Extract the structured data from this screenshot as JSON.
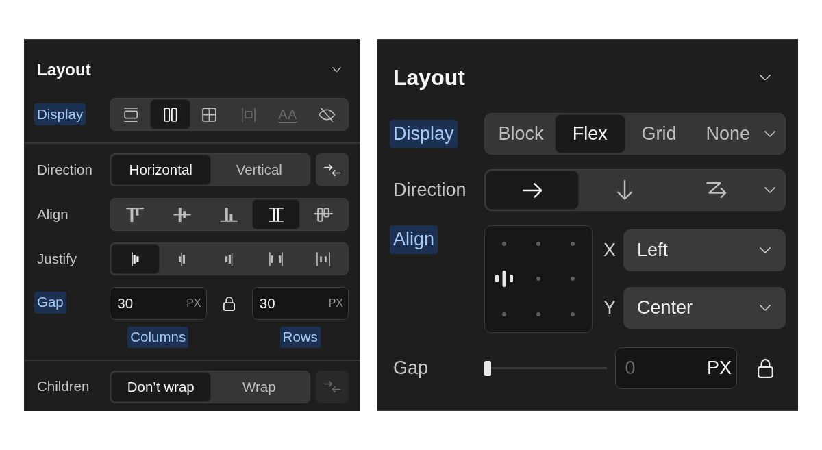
{
  "left_panel": {
    "title": "Layout",
    "sections": [
      {
        "rows": [
          {
            "kind": "icons",
            "label": "Display",
            "highlighted": true,
            "options": [
              {
                "kind": "block",
                "selected": false,
                "disabled": false
              },
              {
                "kind": "flex",
                "selected": true,
                "disabled": false
              },
              {
                "kind": "grid",
                "selected": false,
                "disabled": false
              },
              {
                "kind": "inline_block",
                "selected": false,
                "disabled": true
              },
              {
                "kind": "inline",
                "text": "AA",
                "selected": false,
                "disabled": true
              },
              {
                "kind": "none",
                "selected": false,
                "disabled": false
              }
            ]
          }
        ]
      },
      {
        "rows": [
          {
            "kind": "texts",
            "label": "Direction",
            "highlighted": false,
            "options": [
              {
                "text": "Horizontal",
                "selected": true
              },
              {
                "text": "Vertical",
                "selected": false
              }
            ],
            "reverse": {
              "disabled": false
            }
          },
          {
            "kind": "icons",
            "label": "Align",
            "highlighted": false,
            "options": [
              {
                "kind": "align_start",
                "selected": false
              },
              {
                "kind": "align_center",
                "selected": false
              },
              {
                "kind": "align_end",
                "selected": false
              },
              {
                "kind": "align_stretch",
                "selected": true
              },
              {
                "kind": "align_baseline",
                "selected": false
              }
            ]
          },
          {
            "kind": "icons",
            "label": "Justify",
            "highlighted": false,
            "options": [
              {
                "kind": "justify_start",
                "selected": true
              },
              {
                "kind": "justify_center",
                "selected": false
              },
              {
                "kind": "justify_end",
                "selected": false
              },
              {
                "kind": "justify_between",
                "selected": false
              },
              {
                "kind": "justify_around",
                "selected": false
              }
            ]
          },
          {
            "kind": "gap",
            "label": "Gap",
            "highlighted": true,
            "fields": [
              {
                "value": "30",
                "unit": "PX",
                "caption": "Columns",
                "caption_highlighted": true
              },
              {
                "value": "30",
                "unit": "PX",
                "caption": "Rows",
                "caption_highlighted": true
              }
            ]
          }
        ]
      },
      {
        "rows": [
          {
            "kind": "texts",
            "label": "Children",
            "highlighted": false,
            "options": [
              {
                "text": "Don’t wrap",
                "selected": true
              },
              {
                "text": "Wrap",
                "selected": false
              }
            ],
            "reverse": {
              "disabled": true
            }
          }
        ]
      }
    ]
  },
  "right_panel": {
    "title": "Layout",
    "sections": [
      {
        "rows": [
          {
            "kind": "texts",
            "label": "Display",
            "highlighted": true,
            "options": [
              {
                "text": "Block",
                "selected": false
              },
              {
                "text": "Flex",
                "selected": true
              },
              {
                "text": "Grid",
                "selected": false
              },
              {
                "text": "None",
                "selected": false
              }
            ],
            "menu": true
          },
          {
            "kind": "icons",
            "label": "Direction",
            "highlighted": false,
            "options": [
              {
                "kind": "horizontal",
                "selected": true
              },
              {
                "kind": "vertical",
                "selected": false
              },
              {
                "kind": "wrap",
                "selected": false
              }
            ],
            "menu": true
          },
          {
            "kind": "align",
            "label": "Align",
            "highlighted": true,
            "cells": [
              {
                "selected": false
              },
              {
                "selected": false
              },
              {
                "selected": false
              },
              {
                "selected": true
              },
              {
                "selected": false
              },
              {
                "selected": false
              },
              {
                "selected": false
              },
              {
                "selected": false
              },
              {
                "selected": false
              }
            ],
            "selects": [
              {
                "axis": "X",
                "value": "Left"
              },
              {
                "axis": "Y",
                "value": "Center"
              }
            ]
          },
          {
            "kind": "slider",
            "label": "Gap",
            "highlighted": false,
            "level": 0,
            "field": {
              "placeholder": "0",
              "unit": "PX"
            }
          }
        ]
      }
    ]
  }
}
